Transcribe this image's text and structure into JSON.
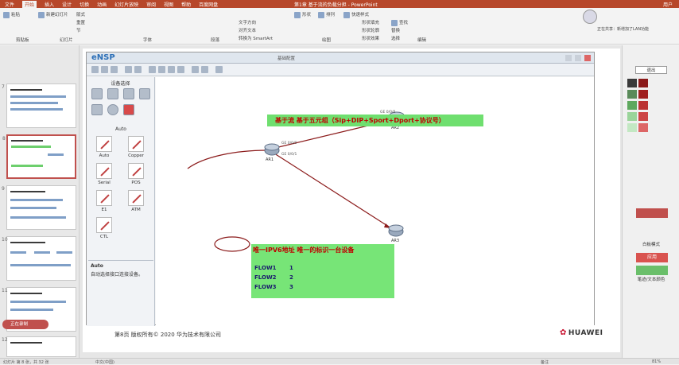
{
  "window": {
    "ribbon_tabs": [
      "文件",
      "开始",
      "插入",
      "设计",
      "切换",
      "动画",
      "幻灯片放映",
      "审阅",
      "视图",
      "帮助",
      "百度网盘"
    ],
    "doc_title": "第1章 基于流的负载分担 - PowerPoint",
    "user": "用户"
  },
  "ribbon": {
    "paste": "粘贴",
    "new_slide": "新建幻灯片",
    "layout": "版式",
    "reset": "重置",
    "section": "节",
    "shapes": "形状",
    "arrange": "排列",
    "quick_styles": "快速样式",
    "find": "查找",
    "replace": "替换",
    "select": "选择",
    "text_direction": "文字方向",
    "align_text": "对齐文本",
    "convert_smartart": "转换为 SmartArt",
    "shape_fill": "形状填充",
    "shape_outline": "形状轮廓",
    "shape_effects": "形状效果",
    "groups": [
      "剪贴板",
      "幻灯片",
      "字体",
      "段落",
      "绘图",
      "编辑"
    ]
  },
  "thumbnails": [
    {
      "number": "7"
    },
    {
      "number": "8"
    },
    {
      "number": "9"
    },
    {
      "number": "10"
    },
    {
      "number": "11"
    },
    {
      "number": "12"
    }
  ],
  "ensp": {
    "logo": "eNSP",
    "window_name": "基础配置",
    "device_panel_title": "设备选择",
    "cable_section": "Auto",
    "cables": [
      "Auto",
      "Copper",
      "Serial",
      "POS",
      "E1",
      "ATM",
      "CTL"
    ],
    "desc_title": "Auto",
    "desc_text": "自动选择接口连接设备。"
  },
  "slide": {
    "banner": "基于流   基于五元组（Sip+DIP+Sport+Dport+协议号）",
    "highlight": "唯一IPV6地址 唯一的标识一台设备",
    "flows": [
      {
        "label": "FLOW1",
        "num": "1"
      },
      {
        "label": "FLOW2",
        "num": "2"
      },
      {
        "label": "FLOW3",
        "num": "3"
      }
    ],
    "routers": [
      {
        "name": "AR1"
      },
      {
        "name": "AR2"
      },
      {
        "name": "AR3"
      }
    ],
    "ports": [
      "GE 0/0/0",
      "GE 0/0/1",
      "GE 0/0/0"
    ],
    "footer": "第8页      版权所有© 2020 华为技术有限公司",
    "brand": "HUAWEI"
  },
  "right_panel": {
    "notice": "正在共享：新增加了LAN功能",
    "exit": "退出",
    "whiteboard": "白板模式",
    "pen": "笔",
    "pen_text_color": "笔迹/文本颜色",
    "apply": "应用"
  },
  "statusbar": {
    "slide_info": "幻灯片 第 8 张，共 32 张",
    "lang": "中文(中国)",
    "notes": "备注",
    "zoom": "81%"
  },
  "recording": "正在录制",
  "colors": {
    "ppt_red": "#b7472a",
    "banner_green": "#6fdf6f",
    "flow_green": "#77e577",
    "annotation_red": "#8b1a1a"
  }
}
